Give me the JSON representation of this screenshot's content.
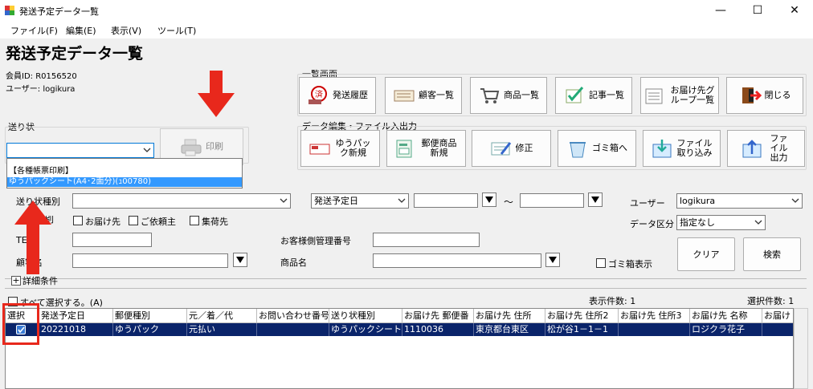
{
  "window": {
    "title": "発送予定データ一覧",
    "minimize": "—",
    "maximize": "☐",
    "close": "✕"
  },
  "menu": [
    "ファイル(F)",
    "編集(E)",
    "表示(V)",
    "ツール(T)"
  ],
  "page_title": "発送予定データ一覧",
  "member_id": "会員ID: R0156520",
  "user": "ユーザー: logikura",
  "list_screen": {
    "label": "一覧画面",
    "buttons": [
      "発送履歴",
      "顧客一覧",
      "商品一覧",
      "記事一覧",
      "お届け先グループ一覧",
      "閉じる"
    ]
  },
  "edit_section": {
    "label": "データ編集・ファイル入出力",
    "buttons": [
      "ゆうパック新規",
      "郵便商品新規",
      "修正",
      "ゴミ箱へ",
      "ファイル取り込み",
      "ファイル出力"
    ]
  },
  "okurijo": {
    "label": "送り状",
    "print": "印刷"
  },
  "dropdown": {
    "items": [
      "【各種帳票印刷】",
      "ゆうパックシート(A4･2面分)(ｭ00780)"
    ]
  },
  "search": {
    "type_label": "送り状種別",
    "date_label": "発送予定日",
    "tilde": "～",
    "user_label": "ユーザー",
    "user_value": "logikura",
    "delivery_dest": "お届け先",
    "requester": "ご依頼主",
    "shipper": "集荷先",
    "data_kubun_label": "データ区分",
    "data_kubun_value": "指定なし",
    "tel_label": "TE",
    "customer_mgmt_label": "お客様側管理番号",
    "customer_name_label": "顧客名",
    "product_name_label": "商品名",
    "trash_label": "ゴミ箱表示",
    "clear": "クリア",
    "search": "検索",
    "detail": "詳細条件"
  },
  "grid_bar": {
    "select_all": "すべて選択する。(A)",
    "display_count": "表示件数: 1",
    "selected_count": "選択件数: 1"
  },
  "grid": {
    "headers": [
      "選択",
      "発送予定日",
      "郵便種別",
      "元／着／代",
      "お問い合わせ番号",
      "送り状種別",
      "お届け先 郵便番",
      "お届け先 住所",
      "お届け先 住所2",
      "お届け先 住所3",
      "お届け先 名称",
      "お届け"
    ],
    "row": [
      "",
      "20221018",
      "ゆうパック",
      "元払い",
      "",
      "ゆうパックシート(A",
      "1110036",
      "東京都台東区",
      "松が谷1－1－1",
      "",
      "ロジクラ花子",
      ""
    ]
  },
  "colors": {
    "selection": "#0a246a",
    "arrow": "#e8281c",
    "dropdown_highlight": "#3399ff"
  }
}
